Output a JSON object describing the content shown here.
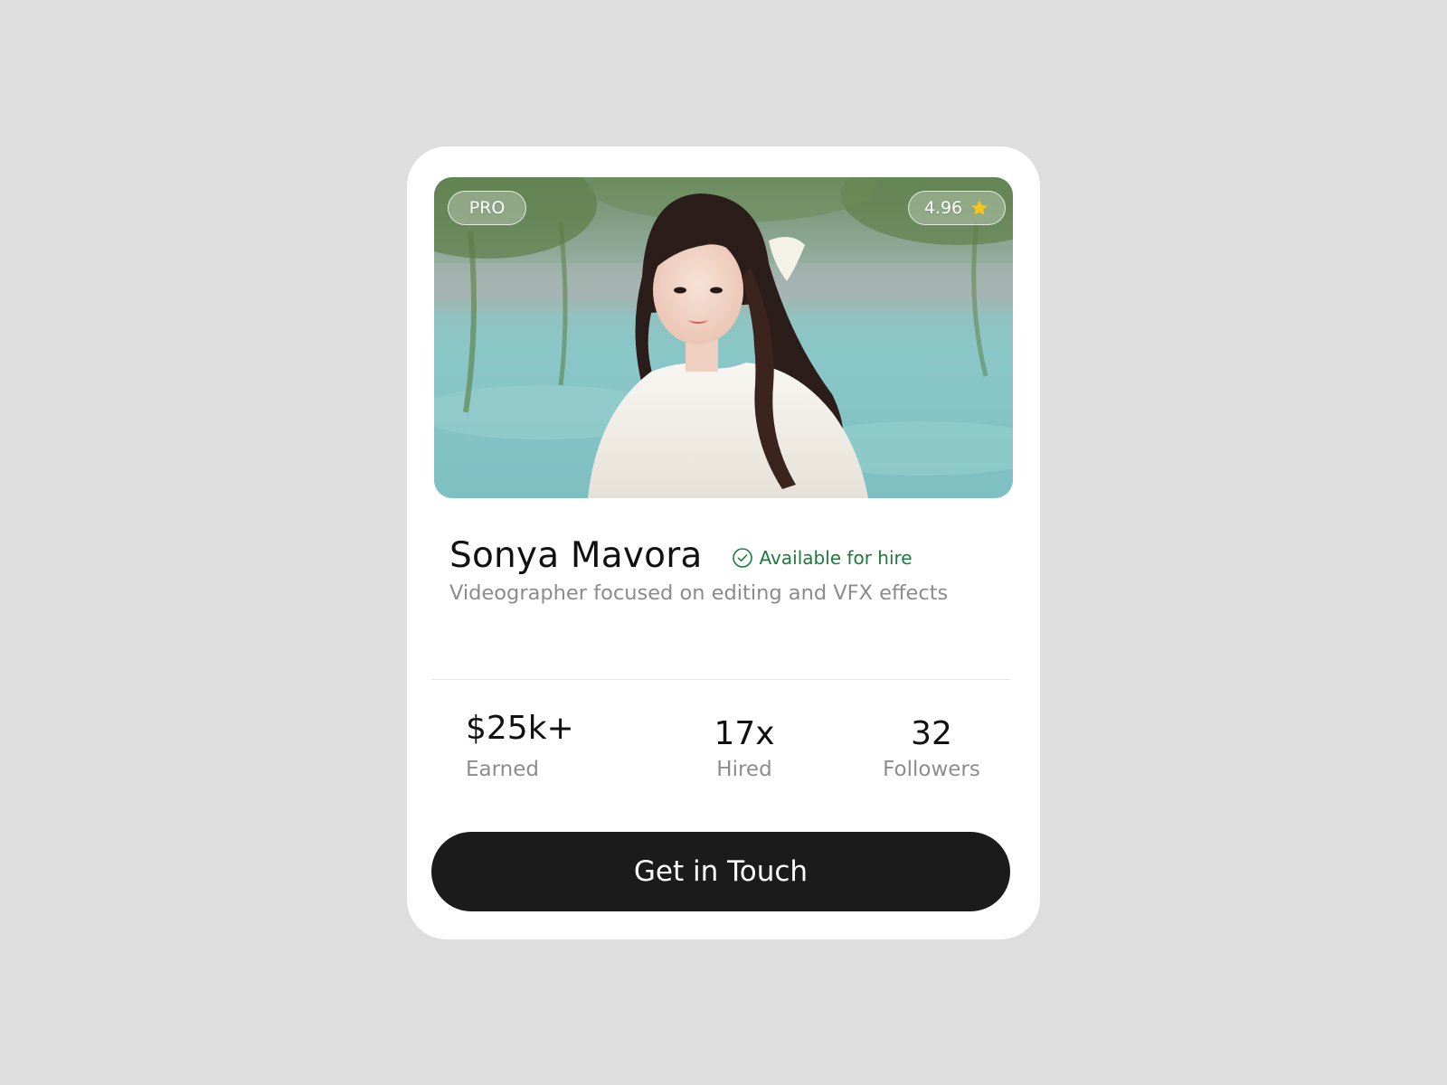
{
  "profile": {
    "badge": "PRO",
    "rating": "4.96",
    "name": "Sonya Mavora",
    "availability": "Available for hire",
    "bio": "Videographer focused on editing and VFX effects"
  },
  "stats": [
    {
      "value": "$25k+",
      "label": "Earned"
    },
    {
      "value": "17x",
      "label": "Hired"
    },
    {
      "value": "32",
      "label": "Followers"
    }
  ],
  "cta": {
    "label": "Get in Touch"
  },
  "icons": {
    "rating": "star-icon",
    "availability": "check-circle-icon"
  },
  "colors": {
    "page_background": "#dedede",
    "card_background": "#ffffff",
    "availability_green": "#1d7a3c",
    "star_gold": "#f5c518",
    "button_background": "#1b1b1b",
    "muted_text": "#8b8b8b"
  }
}
